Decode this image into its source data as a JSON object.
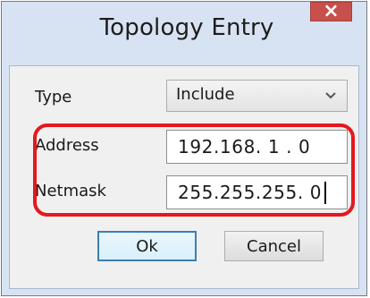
{
  "window": {
    "title": "Topology Entry",
    "close_icon": "close-icon",
    "close_glyph": "×"
  },
  "form": {
    "type_label": "Type",
    "type_value": "Include",
    "type_dropdown_icon": "chevron-down-icon",
    "address_label": "Address",
    "address_value": "192.168. 1 . 0",
    "netmask_label": "Netmask",
    "netmask_value": "255.255.255. 0"
  },
  "buttons": {
    "ok_label": "Ok",
    "cancel_label": "Cancel"
  },
  "colors": {
    "highlight": "#e5171f",
    "close_button": "#c7504c",
    "frame": "#d7e3f3",
    "client": "#f0f0f0"
  }
}
